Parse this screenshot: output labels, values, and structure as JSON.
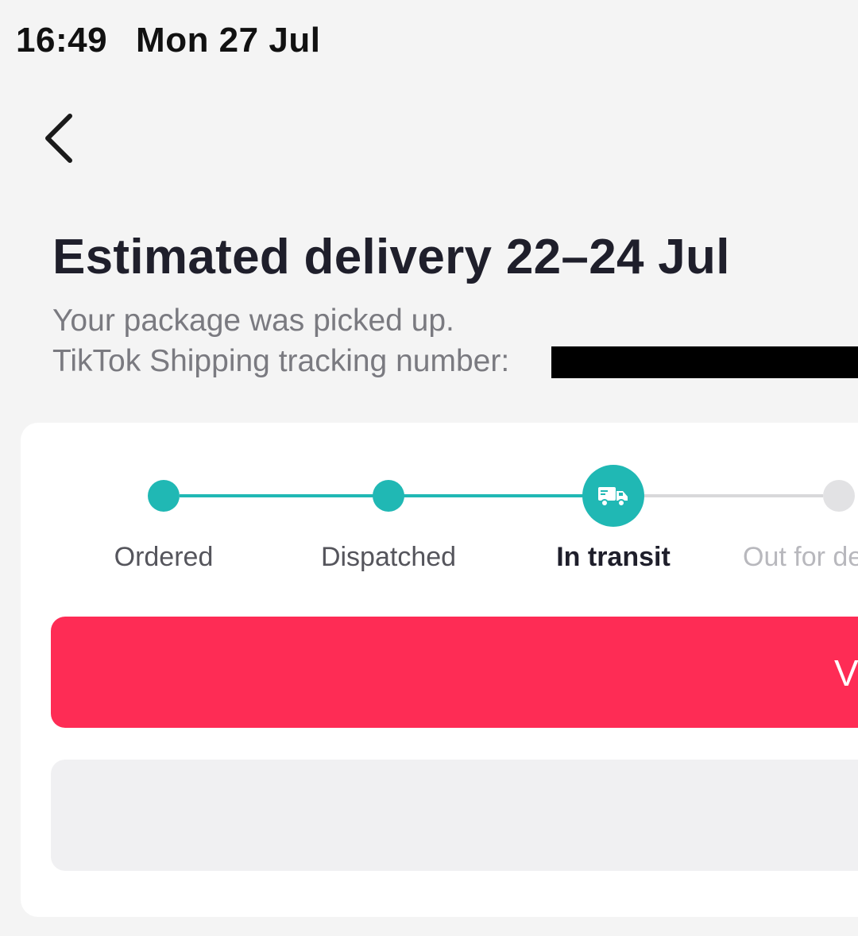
{
  "status_bar": {
    "time": "16:49",
    "date": "Mon 27 Jul"
  },
  "header": {
    "back_icon": "chevron-left-icon"
  },
  "delivery": {
    "title": "Estimated delivery 22–24 Jul",
    "status_text": "Your package was picked up.",
    "tracking_label": "TikTok Shipping tracking number:"
  },
  "progress": {
    "steps": [
      {
        "label": "Ordered",
        "state": "done"
      },
      {
        "label": "Dispatched",
        "state": "done"
      },
      {
        "label": "In transit",
        "state": "current",
        "icon": "truck-icon"
      },
      {
        "label": "Out for de",
        "state": "pending"
      }
    ]
  },
  "actions": {
    "primary_label": "V",
    "secondary_label": ""
  },
  "colors": {
    "accent_teal": "#20b8b4",
    "primary_red": "#fe2c55",
    "pending_gray": "#e2e2e4"
  }
}
